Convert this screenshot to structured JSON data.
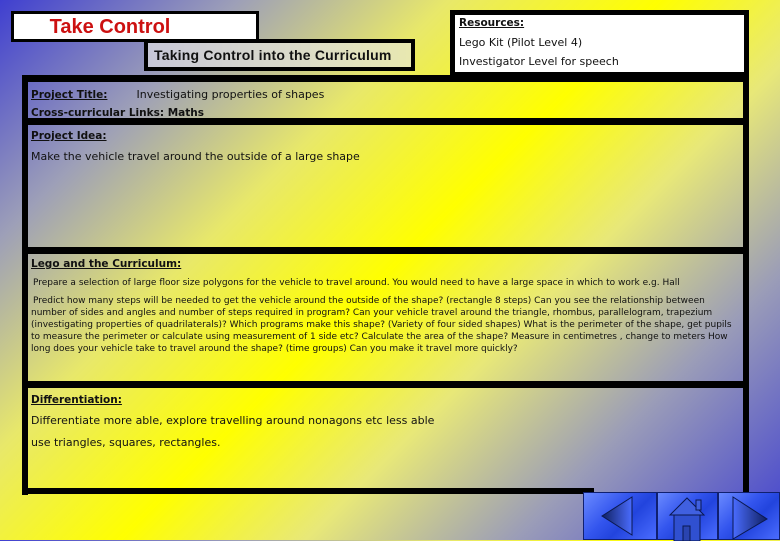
{
  "header": {
    "title": "Take Control",
    "subtitle": "Taking Control into the Curriculum"
  },
  "resources": {
    "label": "Resources:",
    "items": [
      "Lego Kit (Pilot Level 4)",
      "Investigator Level for speech"
    ]
  },
  "project": {
    "title_label": "Project Title:",
    "title_value": "Investigating properties of shapes",
    "links_label": "Cross-curricular Links:",
    "links_value": "Maths"
  },
  "idea": {
    "label": "Project Idea:",
    "text": "Make the vehicle travel around the outside of a large shape"
  },
  "curriculum": {
    "label": "Lego and the Curriculum:",
    "para1": "Prepare a selection of large floor size polygons for the vehicle to travel around. You would need to have a large space in which to work e.g. Hall",
    "para2": "Predict how many steps will be needed to get the vehicle around the outside of the shape? (rectangle 8 steps) Can you see the relationship between number of sides and angles and number of steps required in program? Can your vehicle travel around the triangle, rhombus, parallelogram, trapezium (investigating properties of quadrilaterals)? Which programs make this shape? (Variety of four sided shapes) What is the perimeter of the shape, get pupils to measure the perimeter or calculate using measurement of 1 side etc? Calculate the area of the shape? Measure in centimetres , change to meters How long does your vehicle take to travel around the shape? (time groups) Can you make it travel more quickly?"
  },
  "differentiation": {
    "label": "Differentiation:",
    "line1": "Differentiate more able, explore travelling around nonagons etc less able",
    "line2": "use triangles, squares, rectangles."
  },
  "nav": {
    "icons": [
      "previous-arrow-icon",
      "home-icon",
      "next-arrow-icon"
    ],
    "color": "#3355ee"
  }
}
